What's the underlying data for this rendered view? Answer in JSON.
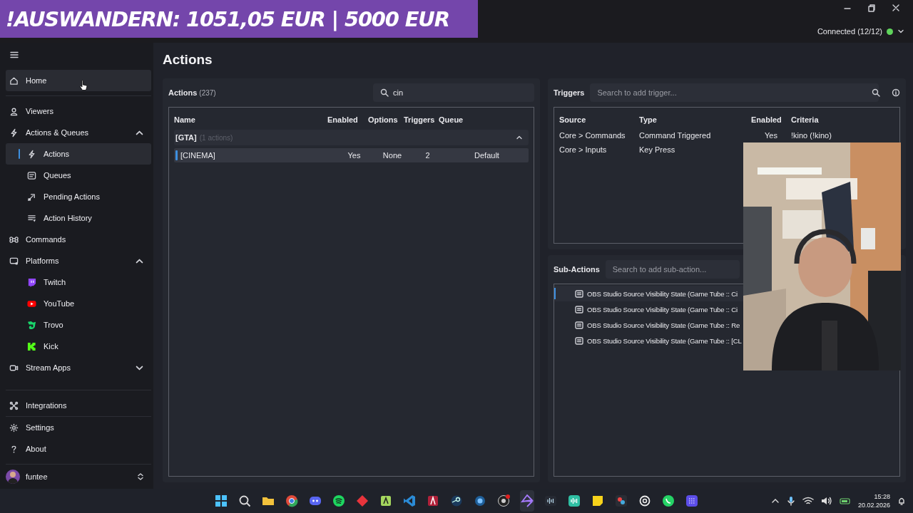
{
  "overlay_banner": {
    "text": "!AUSWANDERN: 1051,05 EUR | 5000 EUR"
  },
  "window": {
    "connection": {
      "label": "Connected (12/12)",
      "connected": true
    }
  },
  "sidebar": {
    "items": [
      {
        "label": "Home",
        "highlighted": true,
        "selected": false
      },
      {
        "label": "Viewers",
        "highlighted": false,
        "selected": false
      },
      {
        "label": "Actions & Queues",
        "highlighted": false,
        "selected": false,
        "expanded": true,
        "children": [
          {
            "label": "Actions",
            "highlighted": true,
            "selected": true
          },
          {
            "label": "Queues",
            "highlighted": false,
            "selected": false
          },
          {
            "label": "Pending Actions",
            "highlighted": false,
            "selected": false
          },
          {
            "label": "Action History",
            "highlighted": false,
            "selected": false
          }
        ]
      },
      {
        "label": "Commands",
        "highlighted": false,
        "selected": false
      },
      {
        "label": "Platforms",
        "highlighted": false,
        "selected": false,
        "expanded": true,
        "children": [
          {
            "label": "Twitch",
            "highlighted": false,
            "selected": false
          },
          {
            "label": "YouTube",
            "highlighted": false,
            "selected": false
          },
          {
            "label": "Trovo",
            "highlighted": false,
            "selected": false
          },
          {
            "label": "Kick",
            "highlighted": false,
            "selected": false
          }
        ]
      },
      {
        "label": "Stream Apps",
        "highlighted": false,
        "selected": false,
        "expanded": false
      }
    ],
    "footer_items": [
      {
        "label": "Integrations"
      },
      {
        "label": "Settings"
      },
      {
        "label": "About"
      }
    ],
    "user": {
      "name": "funtee"
    }
  },
  "page_title": "Actions",
  "actions": {
    "title": "Actions",
    "count": "(237)",
    "search": {
      "value": "cin"
    },
    "columns": [
      "Name",
      "Enabled",
      "Options",
      "Triggers",
      "Queue"
    ],
    "groups": [
      {
        "name": "[GTA]",
        "count": "(1 actions)",
        "expanded": true,
        "rows": [
          {
            "name": "[CINEMA]",
            "enabled": "Yes",
            "options": "None",
            "triggers": "2",
            "queue": "Default",
            "selected": true
          }
        ]
      }
    ]
  },
  "triggers": {
    "title": "Triggers",
    "search": {
      "placeholder": "Search to add trigger..."
    },
    "columns": [
      "Source",
      "Type",
      "Enabled",
      "Criteria"
    ],
    "rows": [
      {
        "source": "Core > Commands",
        "type": "Command Triggered",
        "enabled": "Yes",
        "criteria": "!kino (!kino)"
      },
      {
        "source": "Core > Inputs",
        "type": "Key Press"
      }
    ]
  },
  "sub_actions": {
    "title": "Sub-Actions",
    "search": {
      "placeholder": "Search to add sub-action..."
    },
    "rows": [
      {
        "text": "OBS Studio Source Visibility State (Game Tube :: Ci",
        "selected": true
      },
      {
        "text": "OBS Studio Source Visibility State (Game Tube :: Ci",
        "selected": false
      },
      {
        "text": "OBS Studio Source Visibility State (Game Tube :: Re",
        "selected": false
      },
      {
        "text": "OBS Studio Source Visibility State (Game Tube :: [CL",
        "selected": false
      }
    ]
  },
  "taskbar": {
    "time": "15:28",
    "date": "20.02.2026"
  }
}
